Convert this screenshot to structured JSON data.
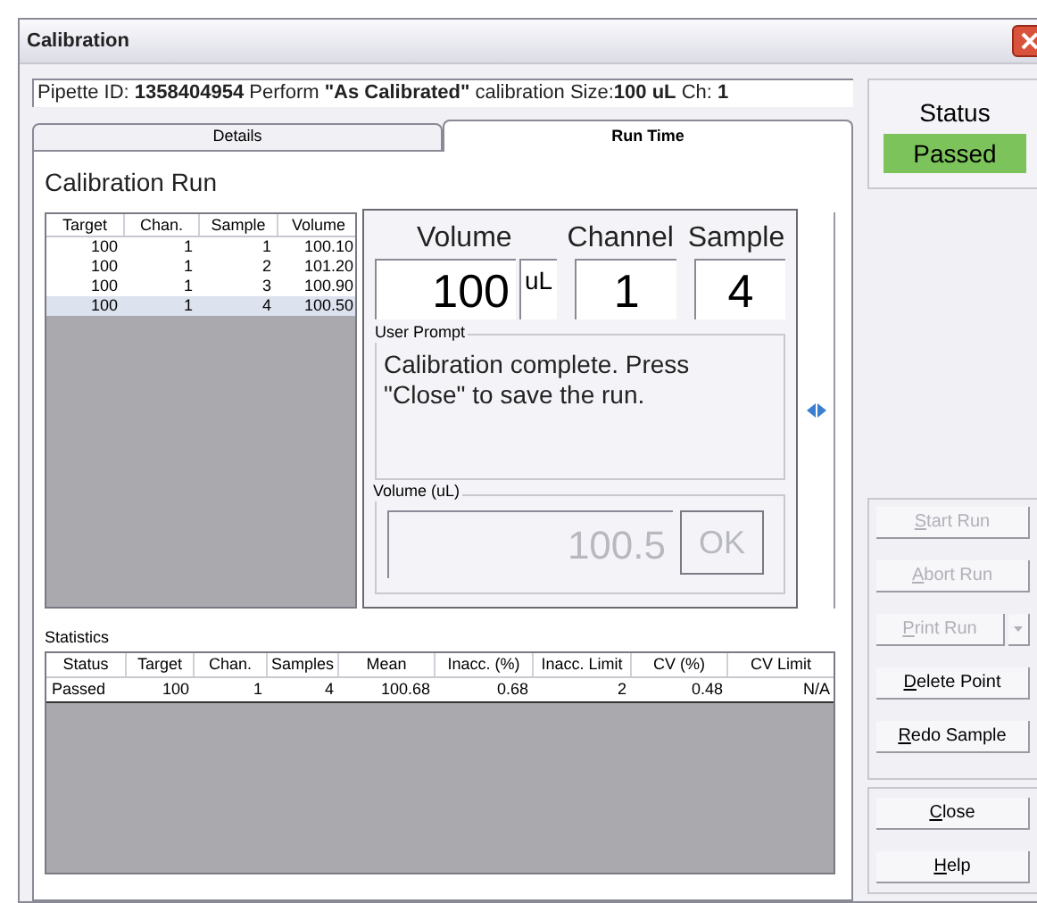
{
  "window": {
    "title": "Calibration"
  },
  "info": "Pipette ID: **1358404954**   Perform **\"As Calibrated\"** calibration   Size:**100 uL** Ch: **1**",
  "tabs": [
    {
      "label": "Details",
      "selected": false
    },
    {
      "label": "Run Time",
      "selected": true
    }
  ],
  "run": {
    "title": "Calibration Run",
    "table": {
      "columns": [
        "Target",
        "Chan.",
        "Sample",
        "Volume"
      ],
      "rows": [
        {
          "cells": [
            "100",
            "1",
            "1",
            "100.10"
          ],
          "selected": false
        },
        {
          "cells": [
            "100",
            "1",
            "2",
            "101.20"
          ],
          "selected": false
        },
        {
          "cells": [
            "100",
            "1",
            "3",
            "100.90"
          ],
          "selected": false
        },
        {
          "cells": [
            "100",
            "1",
            "4",
            "100.50"
          ],
          "selected": true
        }
      ]
    }
  },
  "dialog": {
    "volume_label": "Volume",
    "channel_label": "Channel",
    "sample_label": "Sample",
    "volume_value": "100",
    "volume_unit": "uL",
    "channel_value": "1",
    "sample_value": "4",
    "prompt_label": "User Prompt",
    "prompt_text": "Calibration complete.  Press \"Close\" to save the run.",
    "input_label": "Volume (uL)",
    "input_value": "100.5",
    "ok": {
      "label": "OK",
      "disabled": true
    }
  },
  "statistics": {
    "label": "Statistics",
    "columns": [
      "Status",
      "Target",
      "Chan.",
      "Samples",
      "Mean",
      "Inacc. (%)",
      "Inacc. Limit",
      "CV (%)",
      "CV Limit"
    ],
    "rows": [
      [
        "Passed",
        "100",
        "1",
        "4",
        "100.68",
        "0.68",
        "2",
        "0.48",
        "N/A"
      ]
    ]
  },
  "status": {
    "label": "Status",
    "value": "Passed",
    "kind": "passed"
  },
  "buttons": [
    {
      "label": "Start Run",
      "disabled": true,
      "kind": "plain"
    },
    {
      "label": "Abort Run",
      "disabled": true,
      "kind": "plain"
    },
    {
      "label": "Print Run",
      "disabled": true,
      "kind": "split"
    },
    {
      "label": "Delete Point",
      "disabled": false,
      "kind": "plain"
    },
    {
      "label": "Redo Sample",
      "disabled": false,
      "kind": "plain"
    }
  ],
  "footer_buttons": [
    {
      "label": "Close",
      "disabled": false,
      "kind": "plain"
    },
    {
      "label": "Help",
      "disabled": false,
      "kind": "plain"
    }
  ]
}
